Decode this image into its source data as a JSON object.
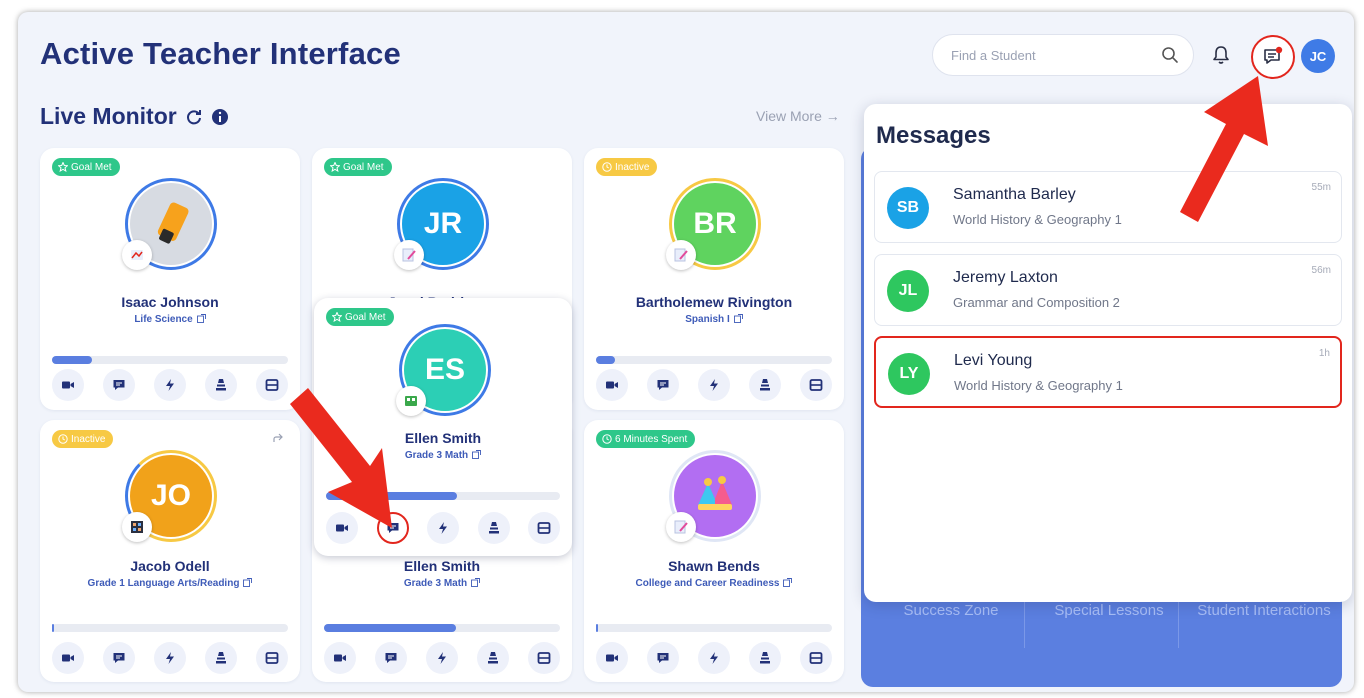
{
  "header": {
    "title": "Active Teacher Interface",
    "search_placeholder": "Find a Student",
    "avatar_initials": "JC"
  },
  "live_monitor": {
    "title": "Live Monitor",
    "view_more": "View More →"
  },
  "students": [
    {
      "badge": "Goal Met",
      "badge_color": "#2ec78a",
      "name": "Isaac Johnson",
      "course": "Life Science",
      "progress": 0.17,
      "avatar": "image"
    },
    {
      "badge": "Goal Met",
      "badge_color": "#2ec78a",
      "name": "Janel Rodriguez",
      "initials": "JR",
      "avatar_color": "#1aa2e6"
    },
    {
      "badge": "Inactive",
      "badge_color": "#f7c944",
      "name": "Bartholemew Rivington",
      "course": "Spanish I",
      "initials": "BR",
      "avatar_color": "#5fd35f",
      "progress": 0.08
    },
    {
      "badge": "Goal Met",
      "badge_color": "#2ec78a",
      "name": "Ellen Smith",
      "course": "Grade 3 Math",
      "initials": "ES",
      "avatar_color": "#2ccfb5",
      "progress": 0.56
    },
    {
      "badge": "Inactive",
      "badge_color": "#f7c944",
      "name": "Jacob Odell",
      "course": "Grade 1 Language Arts/Reading",
      "initials": "JO",
      "avatar_color": "#f1a21a",
      "progress": 0.01
    },
    {
      "name": "Ellen Smith",
      "course": "Grade 3 Math",
      "progress": 0.56
    },
    {
      "badge": "6 Minutes Spent",
      "badge_color": "#2ec78a",
      "name": "Shawn Bends",
      "course": "College and Career Readiness",
      "avatar": "image",
      "progress": 0.01
    }
  ],
  "messages": {
    "title": "Messages",
    "items": [
      {
        "initials": "SB",
        "name": "Samantha Barley",
        "course": "World History & Geography 1",
        "time": "55m",
        "color": "#1aa2e6"
      },
      {
        "initials": "JL",
        "name": "Jeremy Laxton",
        "course": "Grammar and Composition 2",
        "time": "56m",
        "color": "#2ec75f"
      },
      {
        "initials": "LY",
        "name": "Levi Young",
        "course": "World History & Geography 1",
        "time": "1h",
        "color": "#2ec75f"
      }
    ]
  },
  "panel": {
    "buttons": [
      "Success Zone",
      "Special Lessons",
      "Student Interactions"
    ]
  },
  "icons": [
    "search-icon",
    "bell-icon",
    "chat-icon",
    "refresh-icon",
    "info-icon",
    "video-icon",
    "message-icon",
    "lightning-icon",
    "stack-icon",
    "film-icon",
    "external-link-icon",
    "star-icon",
    "clock-icon"
  ],
  "colors": {
    "primary": "#223178",
    "accent": "#3e7ae6",
    "highlight": "#e2261d",
    "goal_met": "#2ec78a",
    "inactive": "#f7c944"
  }
}
